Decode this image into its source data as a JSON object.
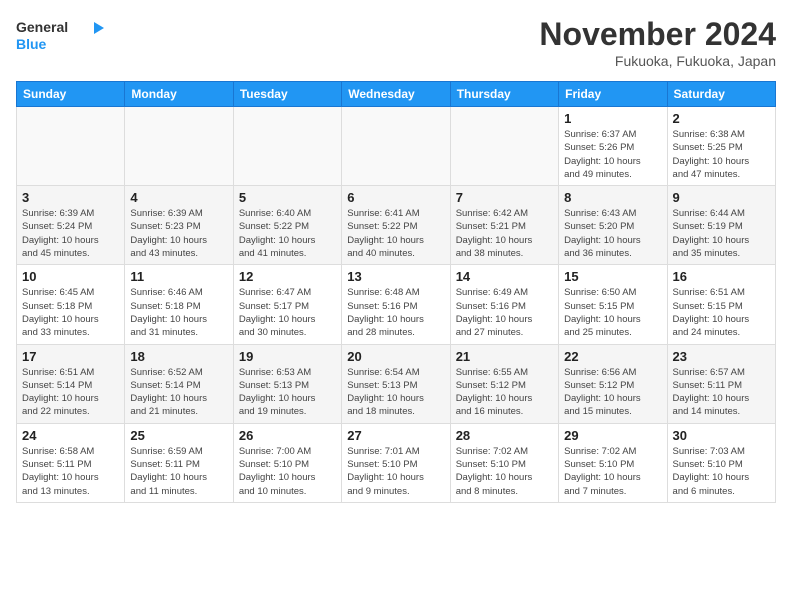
{
  "header": {
    "logo_line1": "General",
    "logo_line2": "Blue",
    "month_title": "November 2024",
    "location": "Fukuoka, Fukuoka, Japan"
  },
  "weekdays": [
    "Sunday",
    "Monday",
    "Tuesday",
    "Wednesday",
    "Thursday",
    "Friday",
    "Saturday"
  ],
  "weeks": [
    [
      {
        "day": "",
        "info": ""
      },
      {
        "day": "",
        "info": ""
      },
      {
        "day": "",
        "info": ""
      },
      {
        "day": "",
        "info": ""
      },
      {
        "day": "",
        "info": ""
      },
      {
        "day": "1",
        "info": "Sunrise: 6:37 AM\nSunset: 5:26 PM\nDaylight: 10 hours\nand 49 minutes."
      },
      {
        "day": "2",
        "info": "Sunrise: 6:38 AM\nSunset: 5:25 PM\nDaylight: 10 hours\nand 47 minutes."
      }
    ],
    [
      {
        "day": "3",
        "info": "Sunrise: 6:39 AM\nSunset: 5:24 PM\nDaylight: 10 hours\nand 45 minutes."
      },
      {
        "day": "4",
        "info": "Sunrise: 6:39 AM\nSunset: 5:23 PM\nDaylight: 10 hours\nand 43 minutes."
      },
      {
        "day": "5",
        "info": "Sunrise: 6:40 AM\nSunset: 5:22 PM\nDaylight: 10 hours\nand 41 minutes."
      },
      {
        "day": "6",
        "info": "Sunrise: 6:41 AM\nSunset: 5:22 PM\nDaylight: 10 hours\nand 40 minutes."
      },
      {
        "day": "7",
        "info": "Sunrise: 6:42 AM\nSunset: 5:21 PM\nDaylight: 10 hours\nand 38 minutes."
      },
      {
        "day": "8",
        "info": "Sunrise: 6:43 AM\nSunset: 5:20 PM\nDaylight: 10 hours\nand 36 minutes."
      },
      {
        "day": "9",
        "info": "Sunrise: 6:44 AM\nSunset: 5:19 PM\nDaylight: 10 hours\nand 35 minutes."
      }
    ],
    [
      {
        "day": "10",
        "info": "Sunrise: 6:45 AM\nSunset: 5:18 PM\nDaylight: 10 hours\nand 33 minutes."
      },
      {
        "day": "11",
        "info": "Sunrise: 6:46 AM\nSunset: 5:18 PM\nDaylight: 10 hours\nand 31 minutes."
      },
      {
        "day": "12",
        "info": "Sunrise: 6:47 AM\nSunset: 5:17 PM\nDaylight: 10 hours\nand 30 minutes."
      },
      {
        "day": "13",
        "info": "Sunrise: 6:48 AM\nSunset: 5:16 PM\nDaylight: 10 hours\nand 28 minutes."
      },
      {
        "day": "14",
        "info": "Sunrise: 6:49 AM\nSunset: 5:16 PM\nDaylight: 10 hours\nand 27 minutes."
      },
      {
        "day": "15",
        "info": "Sunrise: 6:50 AM\nSunset: 5:15 PM\nDaylight: 10 hours\nand 25 minutes."
      },
      {
        "day": "16",
        "info": "Sunrise: 6:51 AM\nSunset: 5:15 PM\nDaylight: 10 hours\nand 24 minutes."
      }
    ],
    [
      {
        "day": "17",
        "info": "Sunrise: 6:51 AM\nSunset: 5:14 PM\nDaylight: 10 hours\nand 22 minutes."
      },
      {
        "day": "18",
        "info": "Sunrise: 6:52 AM\nSunset: 5:14 PM\nDaylight: 10 hours\nand 21 minutes."
      },
      {
        "day": "19",
        "info": "Sunrise: 6:53 AM\nSunset: 5:13 PM\nDaylight: 10 hours\nand 19 minutes."
      },
      {
        "day": "20",
        "info": "Sunrise: 6:54 AM\nSunset: 5:13 PM\nDaylight: 10 hours\nand 18 minutes."
      },
      {
        "day": "21",
        "info": "Sunrise: 6:55 AM\nSunset: 5:12 PM\nDaylight: 10 hours\nand 16 minutes."
      },
      {
        "day": "22",
        "info": "Sunrise: 6:56 AM\nSunset: 5:12 PM\nDaylight: 10 hours\nand 15 minutes."
      },
      {
        "day": "23",
        "info": "Sunrise: 6:57 AM\nSunset: 5:11 PM\nDaylight: 10 hours\nand 14 minutes."
      }
    ],
    [
      {
        "day": "24",
        "info": "Sunrise: 6:58 AM\nSunset: 5:11 PM\nDaylight: 10 hours\nand 13 minutes."
      },
      {
        "day": "25",
        "info": "Sunrise: 6:59 AM\nSunset: 5:11 PM\nDaylight: 10 hours\nand 11 minutes."
      },
      {
        "day": "26",
        "info": "Sunrise: 7:00 AM\nSunset: 5:10 PM\nDaylight: 10 hours\nand 10 minutes."
      },
      {
        "day": "27",
        "info": "Sunrise: 7:01 AM\nSunset: 5:10 PM\nDaylight: 10 hours\nand 9 minutes."
      },
      {
        "day": "28",
        "info": "Sunrise: 7:02 AM\nSunset: 5:10 PM\nDaylight: 10 hours\nand 8 minutes."
      },
      {
        "day": "29",
        "info": "Sunrise: 7:02 AM\nSunset: 5:10 PM\nDaylight: 10 hours\nand 7 minutes."
      },
      {
        "day": "30",
        "info": "Sunrise: 7:03 AM\nSunset: 5:10 PM\nDaylight: 10 hours\nand 6 minutes."
      }
    ]
  ]
}
